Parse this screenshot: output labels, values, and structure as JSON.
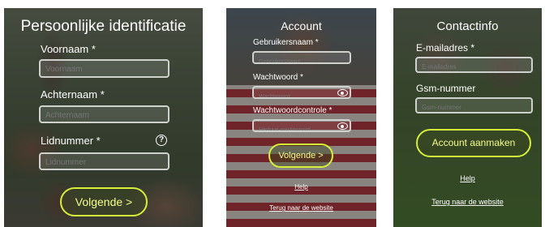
{
  "screen1": {
    "title": "Persoonlijke identificatie",
    "first_name": {
      "label": "Voornaam *",
      "placeholder": "Voornaam"
    },
    "last_name": {
      "label": "Achternaam *",
      "placeholder": "Achternaam"
    },
    "member_number": {
      "label": "Lidnummer *",
      "placeholder": "Lidnummer",
      "help_icon": "question-circle-icon"
    },
    "next_button": "Volgende >"
  },
  "screen2": {
    "title": "Account",
    "username": {
      "label": "Gebruikersnaam *",
      "placeholder": "Gebruikersnaam"
    },
    "password": {
      "label": "Wachtwoord *",
      "placeholder": "Wachtwoord",
      "icon": "eye-icon"
    },
    "password_confirm": {
      "label": "Wachtwoordcontrole *",
      "placeholder": "Herhaal wachtwoord",
      "icon": "eye-icon"
    },
    "next_button": "Volgende >",
    "help_link": "Help",
    "back_link": "Terug naar de website"
  },
  "screen3": {
    "title": "Contactinfo",
    "email": {
      "label": "E-mailadres *",
      "placeholder": "E-mailadres"
    },
    "mobile": {
      "label": "Gsm-nummer",
      "placeholder": "Gsm-nummer"
    },
    "create_button": "Account aanmaken",
    "help_link": "Help",
    "back_link": "Terug naar de website"
  },
  "colors": {
    "accent": "#d6f03a",
    "field_border": "#cfd2cc"
  }
}
